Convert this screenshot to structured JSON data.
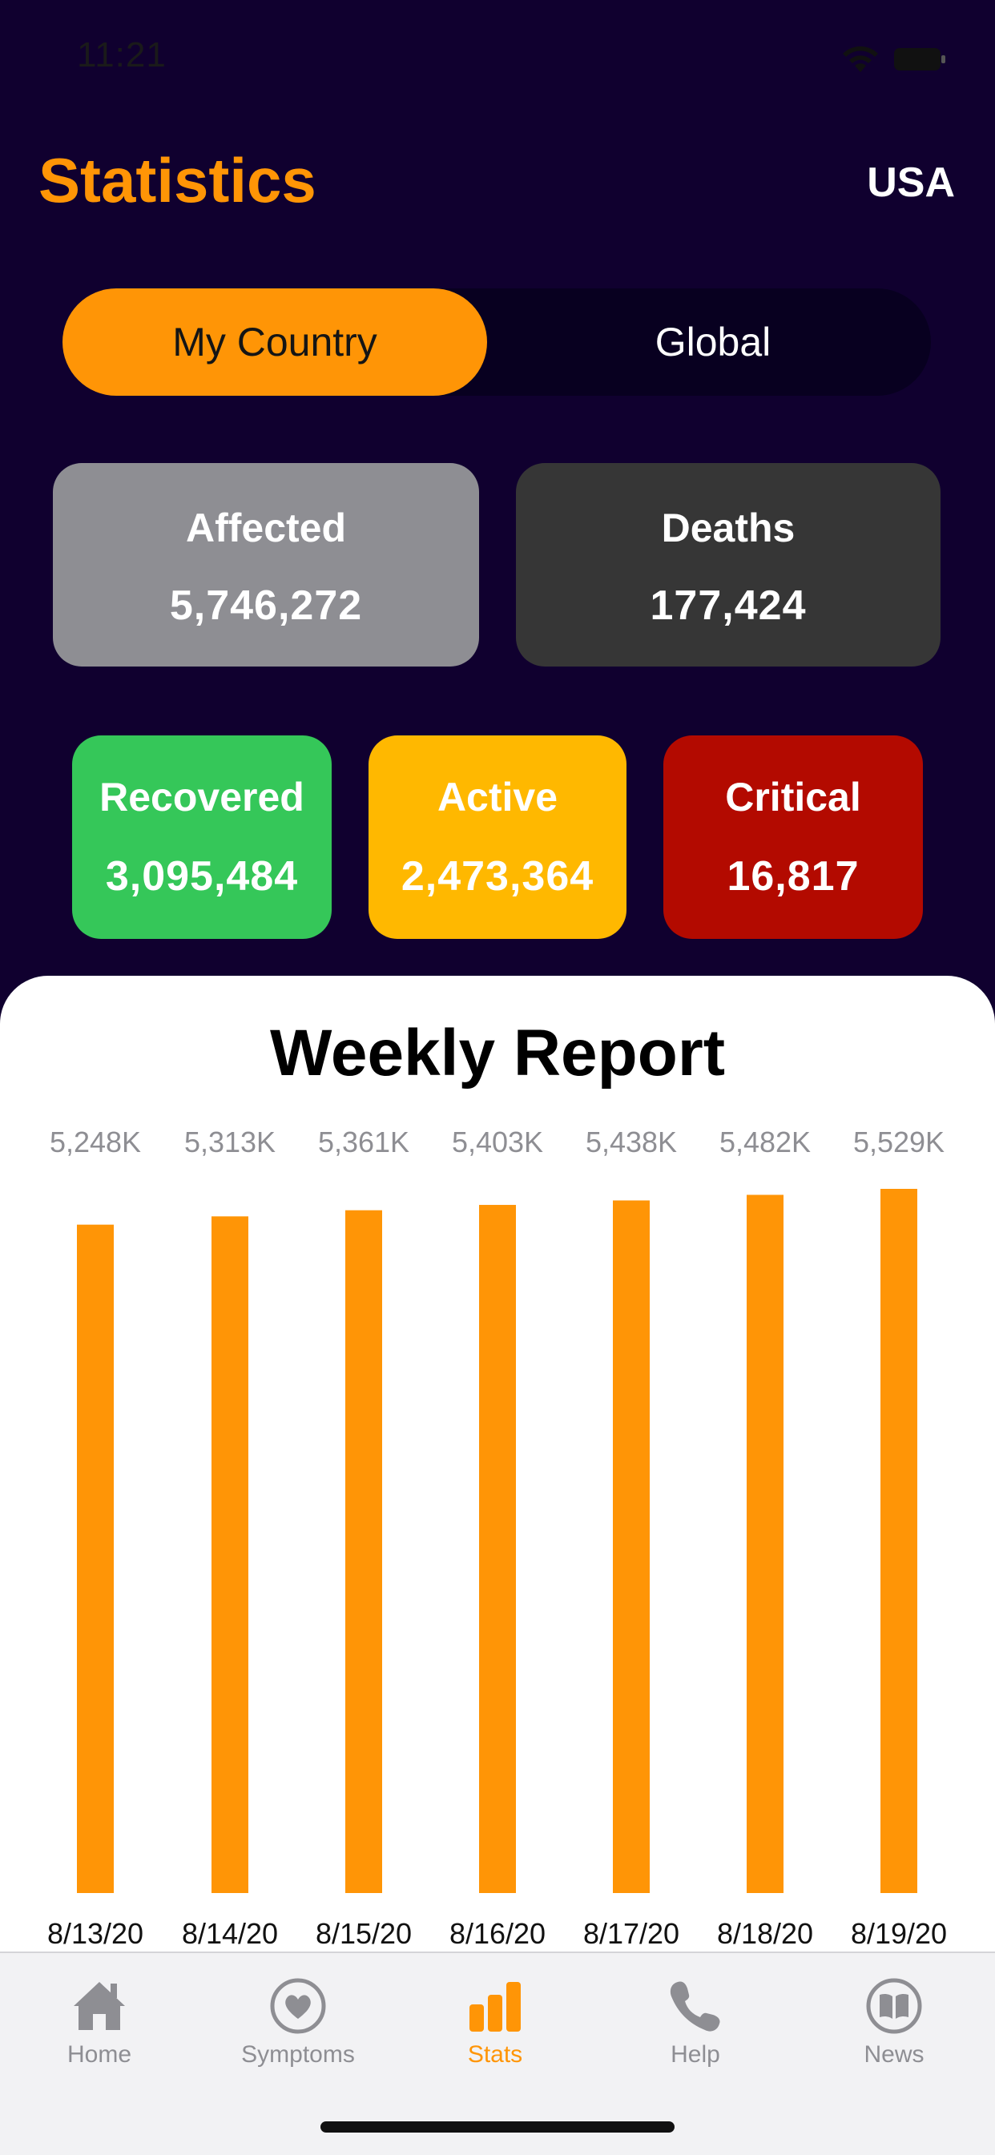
{
  "status_bar": {
    "time": "11:21"
  },
  "header": {
    "title": "Statistics",
    "country": "USA"
  },
  "segmented": {
    "options": [
      "My Country",
      "Global"
    ],
    "selected": "My Country"
  },
  "stats": {
    "affected": {
      "label": "Affected",
      "value": "5,746,272"
    },
    "deaths": {
      "label": "Deaths",
      "value": "177,424"
    },
    "recovered": {
      "label": "Recovered",
      "value": "3,095,484"
    },
    "active": {
      "label": "Active",
      "value": "2,473,364"
    },
    "critical": {
      "label": "Critical",
      "value": "16,817"
    }
  },
  "colors": {
    "background": "#10002f",
    "accent": "#ff9506",
    "affected": "#8e8e93",
    "deaths": "#363636",
    "recovered": "#35c759",
    "active": "#ffb800",
    "critical": "#b30a00"
  },
  "report": {
    "title": "Weekly Report"
  },
  "chart_data": {
    "type": "bar",
    "title": "Weekly Report",
    "categories": [
      "8/13/20",
      "8/14/20",
      "8/15/20",
      "8/16/20",
      "8/17/20",
      "8/18/20",
      "8/19/20"
    ],
    "values": [
      5248,
      5313,
      5361,
      5403,
      5438,
      5482,
      5529
    ],
    "value_labels": [
      "5,248K",
      "5,313K",
      "5,361K",
      "5,403K",
      "5,438K",
      "5,482K",
      "5,529K"
    ],
    "ylim": [
      0,
      5529
    ],
    "bar_color": "#ff9506",
    "grid": false,
    "legend": "none"
  },
  "tabbar": {
    "items": [
      {
        "label": "Home",
        "icon": "house-icon"
      },
      {
        "label": "Symptoms",
        "icon": "heart-icon"
      },
      {
        "label": "Stats",
        "icon": "bar-chart-icon"
      },
      {
        "label": "Help",
        "icon": "phone-icon"
      },
      {
        "label": "News",
        "icon": "book-icon"
      }
    ],
    "selected": "Stats"
  }
}
